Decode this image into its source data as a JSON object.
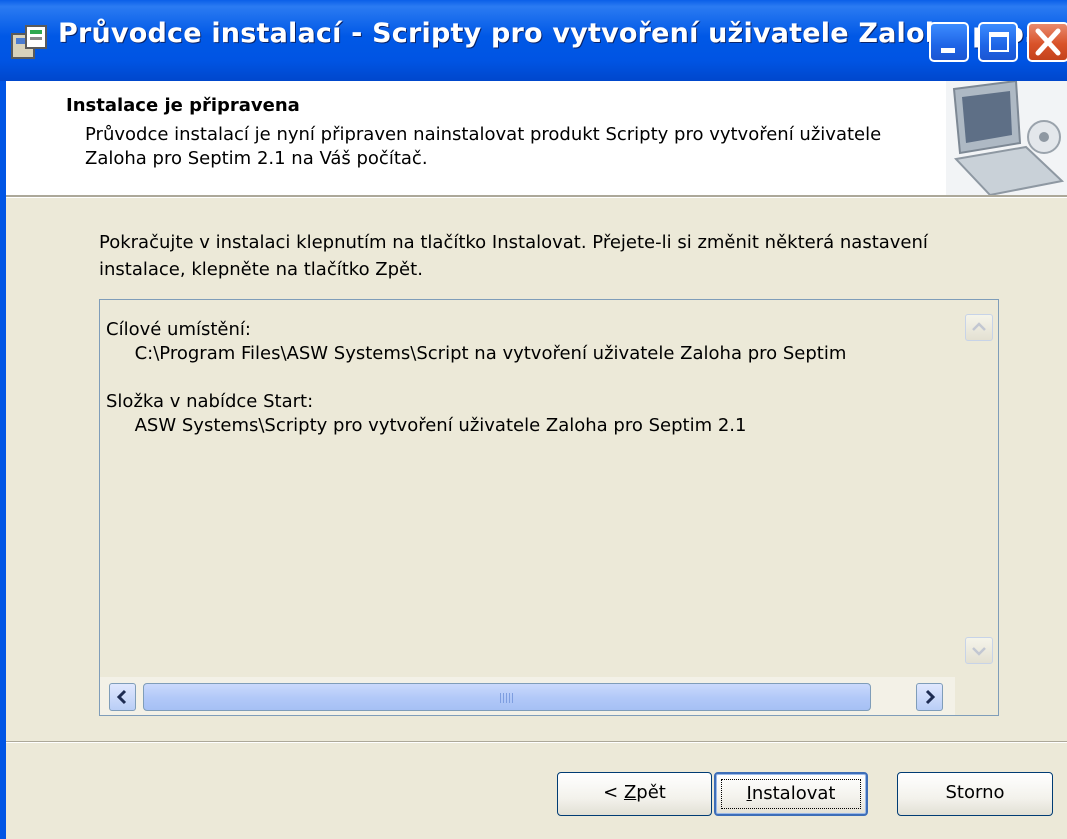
{
  "window": {
    "title": "Průvodce instalací - Scripty pro vytvoření uživatele Zaloha pro...",
    "icon": "installer-icon"
  },
  "header": {
    "title": "Instalace je připravena",
    "description": "Průvodce instalací je nyní připraven nainstalovat produkt Scripty pro vytvoření uživatele Zaloha pro Septim 2.1 na Váš počítač."
  },
  "body": {
    "instructions": "Pokračujte v instalaci klepnutím na tlačítko Instalovat. Přejete-li si změnit některá nastavení instalace, klepněte na tlačítko Zpět.",
    "memo": "Cílové umístění:\n     C:\\Program Files\\ASW Systems\\Script na vytvoření uživatele Zaloha pro Septim\n\nSložka v nabídce Start:\n     ASW Systems\\Scripty pro vytvoření uživatele Zaloha pro Septim 2.1"
  },
  "buttons": {
    "back": {
      "prefix": "< ",
      "accel": "Z",
      "rest": "pět"
    },
    "install": {
      "accel": "I",
      "rest": "nstalovat"
    },
    "cancel": "Storno"
  },
  "colors": {
    "titlebar": "#0054E3",
    "close_button": "#D9532A",
    "window_face": "#ECE9D8"
  }
}
